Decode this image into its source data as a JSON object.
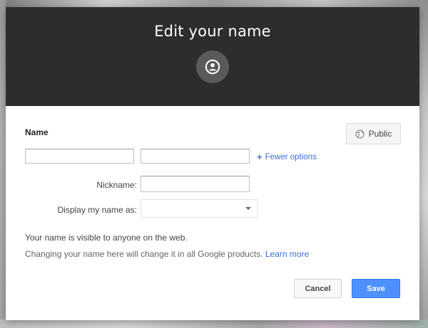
{
  "dialog": {
    "title": "Edit your name",
    "avatar_icon": "user-circle-icon"
  },
  "name_section": {
    "label": "Name",
    "visibility_button": {
      "icon": "globe-icon",
      "label": "Public"
    },
    "first_name": {
      "value": "",
      "placeholder": ""
    },
    "last_name": {
      "value": "",
      "placeholder": ""
    },
    "fewer_options": {
      "icon": "plus-icon",
      "label": "Fewer options"
    },
    "nickname": {
      "label": "Nickname:",
      "value": ""
    },
    "display_as": {
      "label": "Display my name as:",
      "selected": ""
    }
  },
  "info": {
    "visible_notice": "Your name is visible to anyone on the web.",
    "change_notice": "Changing your name here will change it in all Google products.",
    "learn_more": "Learn more"
  },
  "actions": {
    "cancel": "Cancel",
    "save": "Save"
  },
  "colors": {
    "header_bg": "#2d2d2d",
    "link": "#3b6fd9",
    "primary_button": "#4d90fe"
  }
}
